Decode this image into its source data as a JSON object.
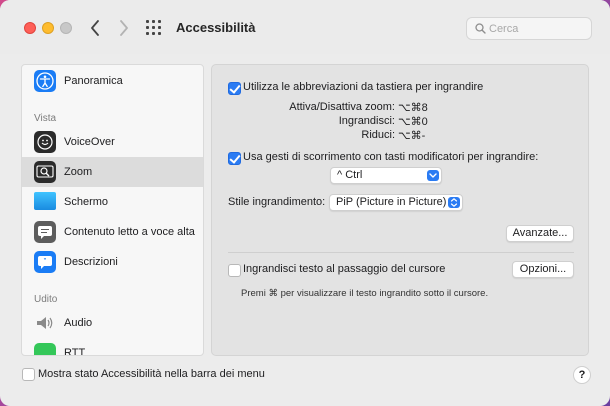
{
  "window": {
    "title": "Accessibilità"
  },
  "search": {
    "placeholder": "Cerca"
  },
  "sidebar": {
    "items": [
      {
        "label": "Panoramica"
      },
      {
        "label": "VoiceOver"
      },
      {
        "label": "Zoom"
      },
      {
        "label": "Schermo"
      },
      {
        "label": "Contenuto letto a voce alta"
      },
      {
        "label": "Descrizioni"
      },
      {
        "label": "Audio"
      },
      {
        "label": "RTT"
      }
    ],
    "sections": {
      "vista": "Vista",
      "udito": "Udito"
    },
    "selected": "Zoom"
  },
  "main": {
    "keyboard_shortcuts": {
      "label": "Utilizza le abbreviazioni da tastiera per ingrandire",
      "checked": true
    },
    "shortcuts": [
      {
        "name": "Attiva/Disattiva zoom:",
        "keys": "⌥⌘8"
      },
      {
        "name": "Ingrandisci:",
        "keys": "⌥⌘0"
      },
      {
        "name": "Riduci:",
        "keys": "⌥⌘-"
      }
    ],
    "scroll_gesture": {
      "label": "Usa gesti di scorrimento con tasti modificatori per ingrandire:",
      "checked": true
    },
    "modifier_select": {
      "value": "^ Ctrl"
    },
    "zoom_style": {
      "label": "Stile ingrandimento:",
      "value": "PiP (Picture in Picture)"
    },
    "advanced_button": "Avanzate...",
    "hover_text": {
      "label": "Ingrandisci testo al passaggio del cursore",
      "checked": false
    },
    "options_button": "Opzioni...",
    "hover_hint": "Premi ⌘ per visualizzare il testo ingrandito sotto il cursore."
  },
  "footer": {
    "menu_bar_status": {
      "label": "Mostra stato Accessibilità nella barra dei menu",
      "checked": false
    },
    "help": "?"
  },
  "colors": {
    "accent": "#2a7bf3",
    "close": "#fe5f57",
    "minimize": "#febc2e"
  }
}
